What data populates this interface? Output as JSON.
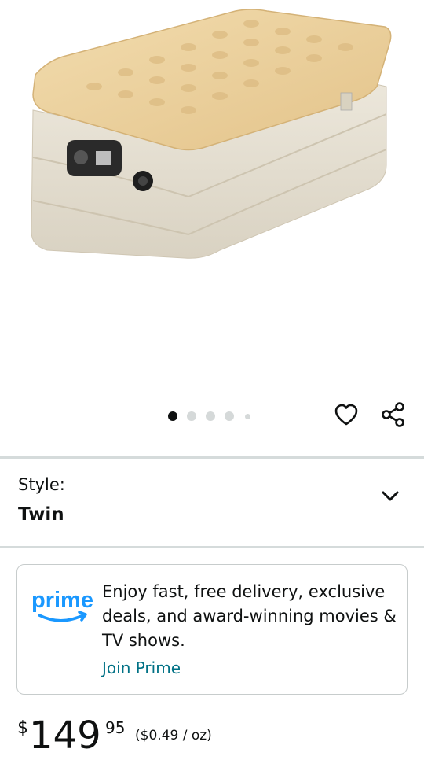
{
  "product": {
    "image_alt": "Inflatable twin air mattress"
  },
  "carousel": {
    "total_dots": 5,
    "active_index": 0
  },
  "actions": {
    "wishlist_icon": "heart-icon",
    "share_icon": "share-icon"
  },
  "style_selector": {
    "label": "Style:",
    "value": "Twin",
    "toggle_icon": "chevron-down-icon"
  },
  "prime_banner": {
    "logo_text": "prime",
    "message": "Enjoy fast, free delivery, exclusive deals, and award-winning movies & TV shows.",
    "link_label": "Join Prime"
  },
  "price": {
    "symbol": "$",
    "whole": "149",
    "fraction": "95",
    "unit_price": "($0.49 / oz)"
  },
  "colors": {
    "link": "#007185",
    "prime_blue": "#1a98ff",
    "divider": "#d5dbdb",
    "text": "#0f1111"
  }
}
